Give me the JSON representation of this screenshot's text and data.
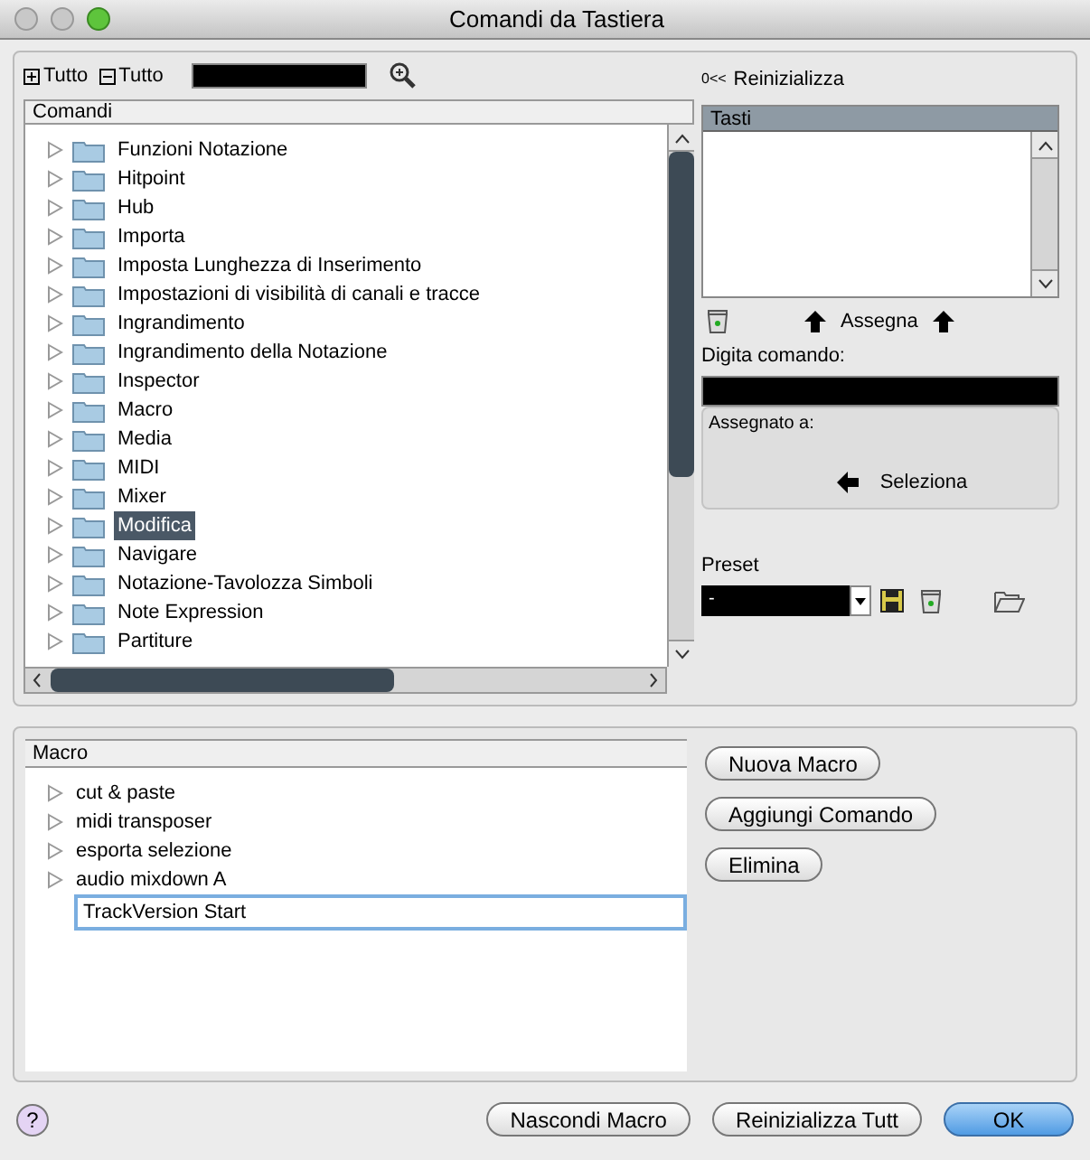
{
  "window": {
    "title": "Comandi da Tastiera"
  },
  "toolbar": {
    "expand_all": "Tutto",
    "collapse_all": "Tutto"
  },
  "commands": {
    "header": "Comandi",
    "items": [
      {
        "label": "Funzioni Notazione",
        "selected": false
      },
      {
        "label": "Hitpoint",
        "selected": false
      },
      {
        "label": "Hub",
        "selected": false
      },
      {
        "label": "Importa",
        "selected": false
      },
      {
        "label": "Imposta Lunghezza di Inserimento",
        "selected": false
      },
      {
        "label": "Impostazioni di visibilità di canali e tracce",
        "selected": false
      },
      {
        "label": "Ingrandimento",
        "selected": false
      },
      {
        "label": "Ingrandimento della Notazione",
        "selected": false
      },
      {
        "label": "Inspector",
        "selected": false
      },
      {
        "label": "Macro",
        "selected": false
      },
      {
        "label": "Media",
        "selected": false
      },
      {
        "label": "MIDI",
        "selected": false
      },
      {
        "label": "Mixer",
        "selected": false
      },
      {
        "label": "Modifica",
        "selected": true
      },
      {
        "label": "Navigare",
        "selected": false
      },
      {
        "label": "Notazione-Tavolozza Simboli",
        "selected": false
      },
      {
        "label": "Note Expression",
        "selected": false
      },
      {
        "label": "Partiture",
        "selected": false
      }
    ]
  },
  "reset": {
    "icon_text": "0<<",
    "label": "Reinizializza"
  },
  "keys": {
    "header": "Tasti"
  },
  "assign": "Assegna",
  "type_command": {
    "label": "Digita comando:"
  },
  "assigned_to": {
    "label": "Assegnato a:",
    "select": "Seleziona"
  },
  "preset": {
    "label": "Preset",
    "value": "-"
  },
  "macros": {
    "header": "Macro",
    "items": [
      "cut & paste",
      "midi transposer",
      "esporta selezione",
      "audio mixdown A"
    ],
    "edit_value": "TrackVersion Start"
  },
  "macro_buttons": [
    "Nuova Macro",
    "Aggiungi Comando",
    "Elimina"
  ],
  "footer": {
    "help": "?",
    "buttons": [
      {
        "label": "Nascondi Macro",
        "primary": false
      },
      {
        "label": "Reinizializza Tutt",
        "primary": false
      },
      {
        "label": "OK",
        "primary": true
      }
    ]
  }
}
